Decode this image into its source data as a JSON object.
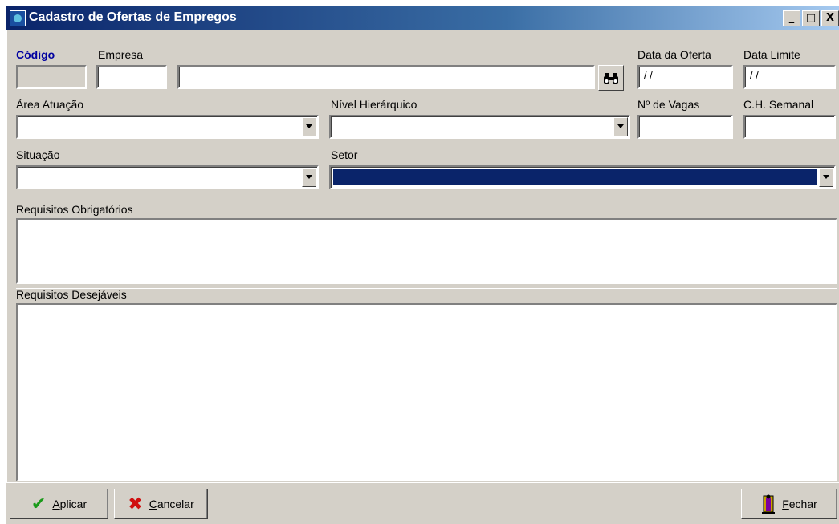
{
  "window": {
    "title": "Cadastro de Ofertas de Empregos",
    "minimize": "_",
    "maximize": "□",
    "close": "X"
  },
  "form": {
    "codigo": {
      "label": "Código",
      "value": ""
    },
    "empresa": {
      "label": "Empresa",
      "code": "",
      "name": ""
    },
    "find_icon": "binoculars-icon",
    "data_oferta": {
      "label": "Data da Oferta",
      "value": "/ /"
    },
    "data_limite": {
      "label": "Data Limite",
      "value": "/ /"
    },
    "area_atuacao": {
      "label": "Área Atuação",
      "value": ""
    },
    "nivel_hierarquico": {
      "label": "Nível Hierárquico",
      "value": ""
    },
    "n_vagas": {
      "label": "Nº de Vagas",
      "value": ""
    },
    "ch_semanal": {
      "label": "C.H. Semanal",
      "value": ""
    },
    "situacao": {
      "label": "Situação",
      "value": ""
    },
    "setor": {
      "label": "Setor",
      "value": ""
    },
    "requisitos_obrigatorios": {
      "label": "Requisitos Obrigatórios",
      "value": ""
    },
    "requisitos_desejaveis": {
      "label": "Requisitos Desejáveis",
      "value": ""
    }
  },
  "buttons": {
    "aplicar": {
      "accel": "A",
      "rest": "plicar"
    },
    "cancelar": {
      "accel": "C",
      "rest": "ancelar"
    },
    "fechar": {
      "accel": "F",
      "rest": "echar"
    }
  },
  "colors": {
    "face": "#d4d0c8",
    "title_start": "#0a246a",
    "title_end": "#a6caf0",
    "selection": "#0a246a",
    "codigo_label": "#0000a0"
  }
}
